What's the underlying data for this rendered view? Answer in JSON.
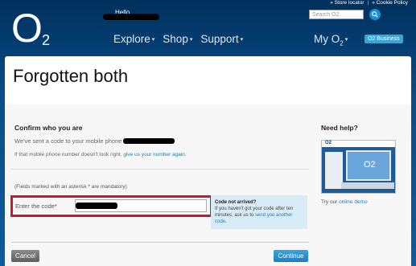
{
  "header": {
    "logo": "O",
    "logo_sub": "2",
    "greeting": "Hello",
    "top_links": [
      "» Store locator",
      "|",
      "» Cookie Policy"
    ],
    "search_placeholder": "Search O2",
    "search_button_icon": "search-icon",
    "nav": [
      {
        "label": "Explore",
        "caret": "▾"
      },
      {
        "label": "Shop",
        "caret": "▾"
      },
      {
        "label": "Support",
        "caret": "▾"
      }
    ],
    "my_o2": "My O",
    "my_o2_sub": "2",
    "my_o2_caret": "▾",
    "o2_business": "O2 Business"
  },
  "page": {
    "title": "Forgotten both",
    "section_title": "Confirm who you are",
    "sent_text": "We've sent a code to your mobile phone",
    "wrong_number_text": "If that mobile phone number doesn't look right,",
    "wrong_number_link": "give us your number again",
    "wrong_number_end": ".",
    "mandatory_text_a": "(Fields marked with an asterisk",
    "mandatory_ast": "*",
    "mandatory_text_b": "are mandatory)",
    "code_label": "Enter the code",
    "code_ast": "*",
    "notice_title": "Code not arrived?",
    "notice_text": "If you haven't got your code after ten minutes, ask us to",
    "notice_link": "send you another code",
    "notice_end": ".",
    "cancel_label": "Cancel",
    "continue_label": "Continue"
  },
  "help": {
    "title": "Need help?",
    "demo_logo": "O2",
    "demo_screen_logo": "O2",
    "try_text": "Try our",
    "try_link": "online demo"
  },
  "colors": {
    "header_bg": "#00305c",
    "accent_blue": "#1a7fc1",
    "highlight_red": "#d0162a",
    "notice_bg": "#d8ebf7"
  }
}
